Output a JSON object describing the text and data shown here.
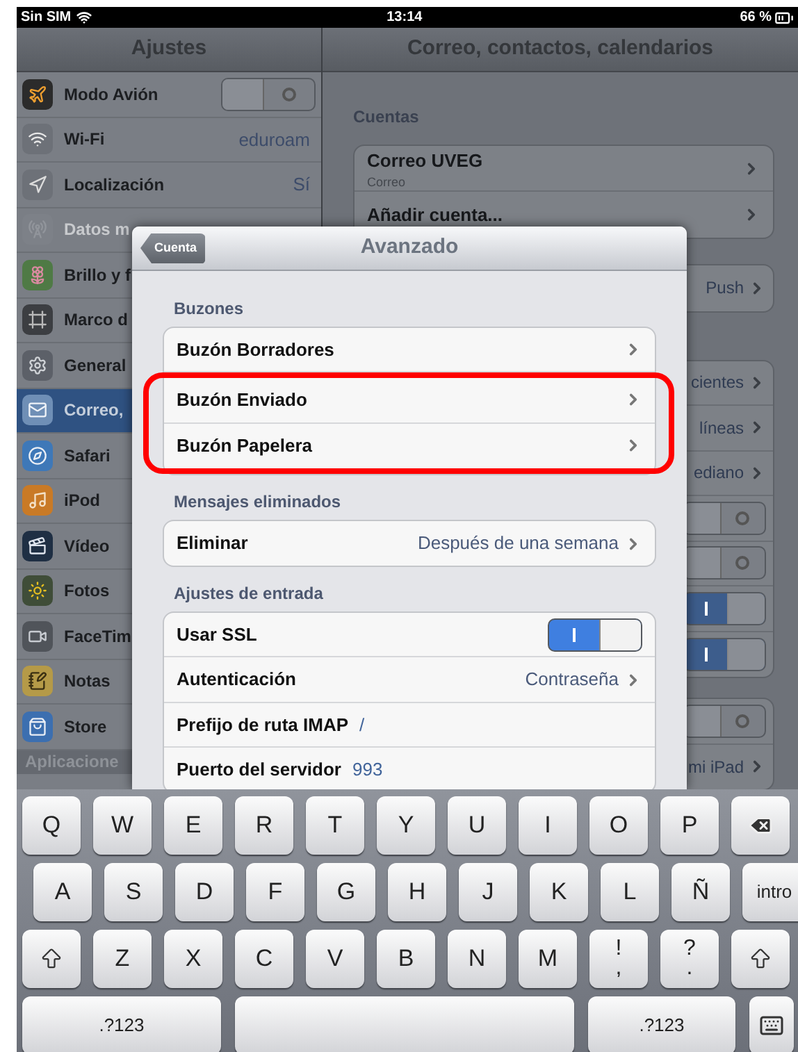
{
  "status_bar": {
    "carrier": "Sin SIM",
    "time": "13:14",
    "battery": "66 %"
  },
  "sidebar": {
    "title": "Ajustes",
    "items": [
      {
        "label": "Modo Avión",
        "kind": "switch",
        "on": false,
        "selected": false,
        "disabled": false
      },
      {
        "label": "Wi-Fi",
        "kind": "value",
        "value": "eduroam",
        "selected": false,
        "disabled": false
      },
      {
        "label": "Localización",
        "kind": "value",
        "value": "Sí",
        "selected": false,
        "disabled": false
      },
      {
        "label": "Datos m",
        "kind": "plain",
        "selected": false,
        "disabled": true
      },
      {
        "label": "Brillo y f",
        "kind": "plain",
        "selected": false,
        "disabled": false
      },
      {
        "label": "Marco d",
        "kind": "plain",
        "selected": false,
        "disabled": false
      },
      {
        "label": "General",
        "kind": "plain",
        "selected": false,
        "disabled": false
      },
      {
        "label": "Correo,",
        "kind": "plain",
        "selected": true,
        "disabled": false
      },
      {
        "label": "Safari",
        "kind": "plain",
        "selected": false,
        "disabled": false
      },
      {
        "label": "iPod",
        "kind": "plain",
        "selected": false,
        "disabled": false
      },
      {
        "label": "Vídeo",
        "kind": "plain",
        "selected": false,
        "disabled": false
      },
      {
        "label": "Fotos",
        "kind": "plain",
        "selected": false,
        "disabled": false
      },
      {
        "label": "FaceTim",
        "kind": "plain",
        "selected": false,
        "disabled": false
      },
      {
        "label": "Notas",
        "kind": "plain",
        "selected": false,
        "disabled": false
      },
      {
        "label": "Store",
        "kind": "plain",
        "selected": false,
        "disabled": false
      }
    ],
    "section_header": "Aplicacione"
  },
  "detail": {
    "title": "Correo, contactos, calendarios",
    "section_header": "Cuentas",
    "accounts": [
      {
        "title": "Correo UVEG",
        "subtitle": "Correo"
      },
      {
        "title": "Añadir cuenta..."
      }
    ],
    "groups": [
      [
        {
          "kind": "value",
          "value": "Push"
        }
      ],
      [
        {
          "kind": "value",
          "value": "cientes"
        },
        {
          "kind": "value",
          "value": "líneas"
        },
        {
          "kind": "value",
          "value": "ediano"
        },
        {
          "kind": "switch",
          "on": false
        },
        {
          "kind": "switch",
          "on": false
        },
        {
          "kind": "switch",
          "on": true
        },
        {
          "kind": "switch",
          "on": true
        }
      ],
      [
        {
          "kind": "switch",
          "on": false
        },
        {
          "kind": "value",
          "value": "mi iPad"
        }
      ]
    ]
  },
  "modal": {
    "back": "Cuenta",
    "title": "Avanzado",
    "sections": [
      {
        "header": "Buzones",
        "rows": [
          {
            "label": "Buzón Borradores",
            "kind": "link",
            "highlighted": false
          },
          {
            "label": "Buzón Enviado",
            "kind": "link",
            "highlighted": true
          },
          {
            "label": "Buzón Papelera",
            "kind": "link",
            "highlighted": true
          }
        ]
      },
      {
        "header": "Mensajes eliminados",
        "rows": [
          {
            "label": "Eliminar",
            "kind": "link",
            "value": "Después de una semana",
            "highlighted": false
          }
        ]
      },
      {
        "header": "Ajustes de entrada",
        "rows": [
          {
            "label": "Usar SSL",
            "kind": "switch",
            "on": true,
            "highlighted": false
          },
          {
            "label": "Autenticación",
            "kind": "link",
            "value": "Contraseña",
            "highlighted": false
          },
          {
            "label": "Prefijo de ruta IMAP",
            "kind": "field",
            "value": "/",
            "highlighted": false
          },
          {
            "label": "Puerto del servidor",
            "kind": "field",
            "value": "993",
            "highlighted": false
          }
        ]
      }
    ]
  },
  "keyboard": {
    "rows": [
      {
        "keys": [
          {
            "kind": "char",
            "label": "Q"
          },
          {
            "kind": "char",
            "label": "W"
          },
          {
            "kind": "char",
            "label": "E"
          },
          {
            "kind": "char",
            "label": "R"
          },
          {
            "kind": "char",
            "label": "T"
          },
          {
            "kind": "char",
            "label": "Y"
          },
          {
            "kind": "char",
            "label": "U"
          },
          {
            "kind": "char",
            "label": "I"
          },
          {
            "kind": "char",
            "label": "O"
          },
          {
            "kind": "char",
            "label": "P"
          },
          {
            "kind": "backspace"
          }
        ]
      },
      {
        "keys": [
          {
            "kind": "char",
            "label": "A"
          },
          {
            "kind": "char",
            "label": "S"
          },
          {
            "kind": "char",
            "label": "D"
          },
          {
            "kind": "char",
            "label": "F"
          },
          {
            "kind": "char",
            "label": "G"
          },
          {
            "kind": "char",
            "label": "H"
          },
          {
            "kind": "char",
            "label": "J"
          },
          {
            "kind": "char",
            "label": "K"
          },
          {
            "kind": "char",
            "label": "L"
          },
          {
            "kind": "char",
            "label": "Ñ"
          },
          {
            "kind": "enter",
            "label": "intro"
          }
        ]
      },
      {
        "keys": [
          {
            "kind": "shift"
          },
          {
            "kind": "char",
            "label": "Z"
          },
          {
            "kind": "char",
            "label": "X"
          },
          {
            "kind": "char",
            "label": "C"
          },
          {
            "kind": "char",
            "label": "V"
          },
          {
            "kind": "char",
            "label": "B"
          },
          {
            "kind": "char",
            "label": "N"
          },
          {
            "kind": "char",
            "label": "M"
          },
          {
            "kind": "dual",
            "top": "!",
            "bottom": ","
          },
          {
            "kind": "dual",
            "top": "?",
            "bottom": "."
          },
          {
            "kind": "shift"
          }
        ]
      },
      {
        "keys": [
          {
            "kind": "mode",
            "label": ".?123"
          },
          {
            "kind": "space"
          },
          {
            "kind": "mode",
            "label": ".?123"
          },
          {
            "kind": "dismiss"
          }
        ]
      }
    ]
  }
}
